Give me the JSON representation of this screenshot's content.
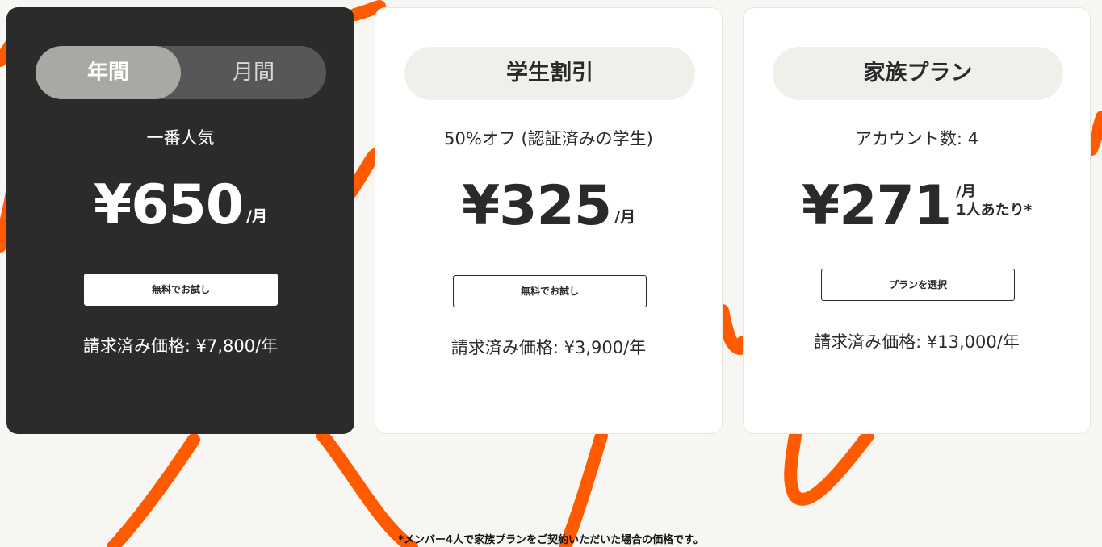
{
  "colors": {
    "accent_orange": "#ff5a00",
    "dark_card": "#2b2b2b",
    "page_background": "#f8f6f2"
  },
  "annual_card": {
    "toggle": {
      "annual_label": "年間",
      "monthly_label": "月間",
      "selected": "年間"
    },
    "subtitle": "一番人気",
    "price": "¥650",
    "period": "/月",
    "cta_label": "無料でお試し",
    "billed": "請求済み価格: ¥7,800/年"
  },
  "student_card": {
    "plan_name": "学生割引",
    "subtitle": "50%オフ (認証済みの学生)",
    "price": "¥325",
    "period": "/月",
    "cta_label": "無料でお試し",
    "billed": "請求済み価格: ¥3,900/年"
  },
  "family_card": {
    "plan_name": "家族プラン",
    "subtitle": "アカウント数: 4",
    "price": "¥271",
    "period": "/月",
    "per_person": "1人あたり*",
    "cta_label": "プランを選択",
    "billed": "請求済み価格: ¥13,000/年"
  },
  "footnote": "*メンバー4人で家族プランをご契約いただいた場合の価格です。"
}
